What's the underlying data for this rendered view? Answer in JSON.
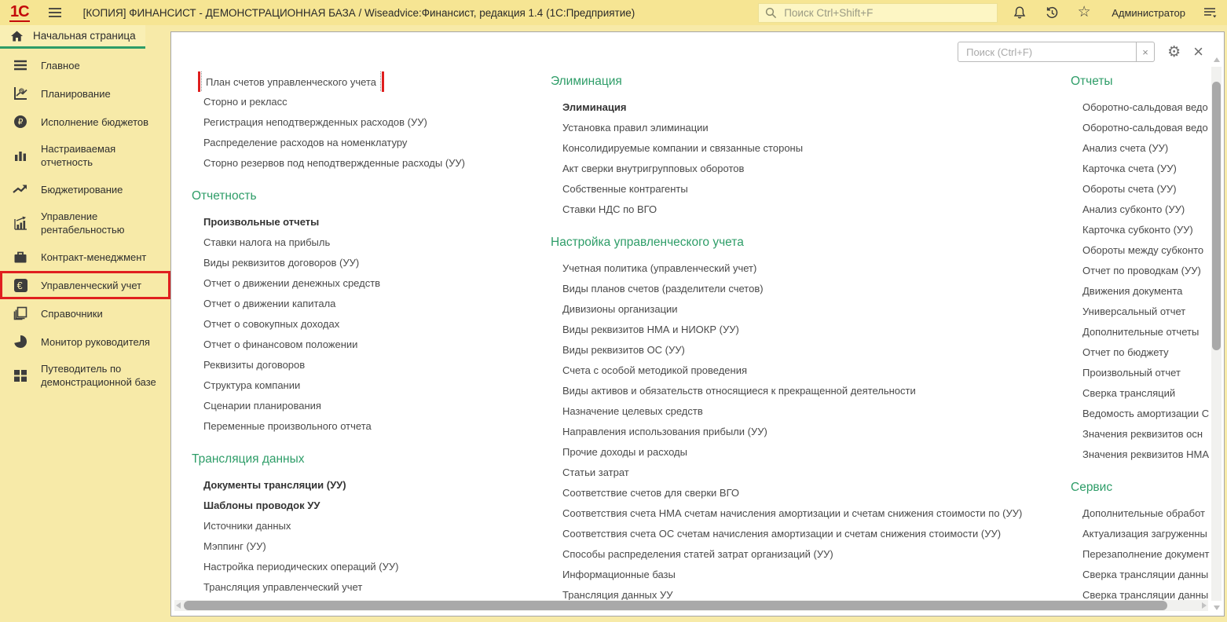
{
  "colors": {
    "topbar_bg": "#f6e593",
    "sidebar_bg": "#f7eaa8",
    "accent_green": "#2e9d68",
    "annotation_red": "#e01f1f",
    "logo_red": "#c40a0a"
  },
  "titlebar": {
    "logo": "1С",
    "title": "[КОПИЯ] ФИНАНСИСТ - ДЕМОНСТРАЦИОННАЯ БАЗА / Wiseadvice:Финансист, редакция 1.4  (1С:Предприятие)",
    "search_placeholder": "Поиск Ctrl+Shift+F",
    "star": "☆",
    "user": "Администратор"
  },
  "tab": {
    "label": "Начальная страница"
  },
  "sidebar": {
    "items": [
      {
        "label": "Главное",
        "icon": "menu-lines-icon"
      },
      {
        "label": "Планирование",
        "icon": "planning-chart-icon"
      },
      {
        "label": "Исполнение бюджетов",
        "icon": "ruble-circle-icon"
      },
      {
        "label": "Настраиваемая отчетность",
        "icon": "bar-chart-icon"
      },
      {
        "label": "Бюджетирование",
        "icon": "trend-arrow-icon"
      },
      {
        "label": "Управление рентабельностью",
        "icon": "profitability-chart-icon"
      },
      {
        "label": "Контракт-менеджмент",
        "icon": "briefcase-icon"
      },
      {
        "label": "Управленческий учет",
        "icon": "euro-badge-icon",
        "highlighted": true
      },
      {
        "label": "Справочники",
        "icon": "catalog-pages-icon"
      },
      {
        "label": "Монитор руководителя",
        "icon": "pie-chart-icon"
      },
      {
        "label": "Путеводитель по демонстрационной базе",
        "icon": "guide-grid-icon"
      }
    ]
  },
  "content": {
    "search_placeholder": "Поиск (Ctrl+F)",
    "clear_button": "×",
    "close_button": "×",
    "columns": [
      {
        "sections": [
          {
            "title": "",
            "items": [
              {
                "label": "План счетов управленческого учета",
                "highlighted": true
              },
              {
                "label": "Сторно и рекласс"
              },
              {
                "label": "Регистрация неподтвержденных расходов (УУ)"
              },
              {
                "label": "Распределение расходов на номенклатуру"
              },
              {
                "label": "Сторно резервов под неподтвержденные расходы (УУ)"
              }
            ]
          },
          {
            "title": "Отчетность",
            "items": [
              {
                "label": "Произвольные отчеты",
                "bold": true
              },
              {
                "label": "Ставки налога на прибыль"
              },
              {
                "label": "Виды реквизитов договоров (УУ)"
              },
              {
                "label": "Отчет о движении денежных средств"
              },
              {
                "label": "Отчет о движении капитала"
              },
              {
                "label": "Отчет о совокупных доходах"
              },
              {
                "label": "Отчет о финансовом положении"
              },
              {
                "label": "Реквизиты договоров"
              },
              {
                "label": "Структура компании"
              },
              {
                "label": "Сценарии планирования"
              },
              {
                "label": "Переменные произвольного отчета"
              }
            ]
          },
          {
            "title": "Трансляция данных",
            "items": [
              {
                "label": "Документы трансляции (УУ)",
                "bold": true
              },
              {
                "label": "Шаблоны проводок УУ",
                "bold": true
              },
              {
                "label": "Источники данных"
              },
              {
                "label": "Мэппинг (УУ)"
              },
              {
                "label": "Настройка периодических операций (УУ)"
              },
              {
                "label": "Трансляция управленческий учет"
              }
            ]
          }
        ]
      },
      {
        "sections": [
          {
            "title": "Элиминация",
            "items": [
              {
                "label": "Элиминация",
                "bold": true
              },
              {
                "label": "Установка правил элиминации"
              },
              {
                "label": "Консолидируемые компании и связанные стороны"
              },
              {
                "label": "Акт сверки внутригрупповых оборотов"
              },
              {
                "label": "Собственные контрагенты"
              },
              {
                "label": "Ставки НДС по ВГО"
              }
            ]
          },
          {
            "title": "Настройка управленческого учета",
            "items": [
              {
                "label": "Учетная политика (управленческий учет)"
              },
              {
                "label": "Виды планов счетов (разделители счетов)"
              },
              {
                "label": "Дивизионы организации"
              },
              {
                "label": "Виды реквизитов НМА и НИОКР (УУ)"
              },
              {
                "label": "Виды реквизитов ОС (УУ)"
              },
              {
                "label": "Счета с особой методикой проведения"
              },
              {
                "label": "Виды активов и обязательств относящиеся к прекращенной деятельности"
              },
              {
                "label": "Назначение целевых средств"
              },
              {
                "label": "Направления использования прибыли (УУ)"
              },
              {
                "label": "Прочие доходы и расходы"
              },
              {
                "label": "Статьи затрат"
              },
              {
                "label": "Соответствие счетов для сверки ВГО"
              },
              {
                "label": "Соответствия счета НМА счетам начисления амортизации и счетам снижения стоимости по (УУ)"
              },
              {
                "label": "Соответствия счета ОС счетам начисления амортизации и счетам снижения стоимости (УУ)"
              },
              {
                "label": "Способы распределения статей затрат организаций (УУ)"
              },
              {
                "label": "Информационные базы"
              },
              {
                "label": "Трансляция данных УУ"
              }
            ]
          }
        ]
      },
      {
        "sections": [
          {
            "title": "Отчеты",
            "items": [
              {
                "label": "Оборотно-сальдовая ведо"
              },
              {
                "label": "Оборотно-сальдовая ведо"
              },
              {
                "label": "Анализ счета (УУ)"
              },
              {
                "label": "Карточка счета (УУ)"
              },
              {
                "label": "Обороты счета (УУ)"
              },
              {
                "label": "Анализ субконто (УУ)"
              },
              {
                "label": "Карточка субконто (УУ)"
              },
              {
                "label": "Обороты между субконто"
              },
              {
                "label": "Отчет по проводкам (УУ)"
              },
              {
                "label": "Движения документа"
              },
              {
                "label": "Универсальный отчет"
              },
              {
                "label": "Дополнительные отчеты"
              },
              {
                "label": "Отчет по бюджету"
              },
              {
                "label": "Произвольный отчет"
              },
              {
                "label": "Сверка трансляций"
              },
              {
                "label": "Ведомость амортизации С"
              },
              {
                "label": "Значения реквизитов осн"
              },
              {
                "label": "Значения реквизитов НМА"
              }
            ]
          },
          {
            "title": "Сервис",
            "items": [
              {
                "label": "Дополнительные обработ"
              },
              {
                "label": "Актуализация загруженны"
              },
              {
                "label": "Перезаполнение документ"
              },
              {
                "label": "Сверка трансляции данны"
              },
              {
                "label": "Сверка трансляции данны"
              }
            ]
          }
        ]
      }
    ]
  }
}
